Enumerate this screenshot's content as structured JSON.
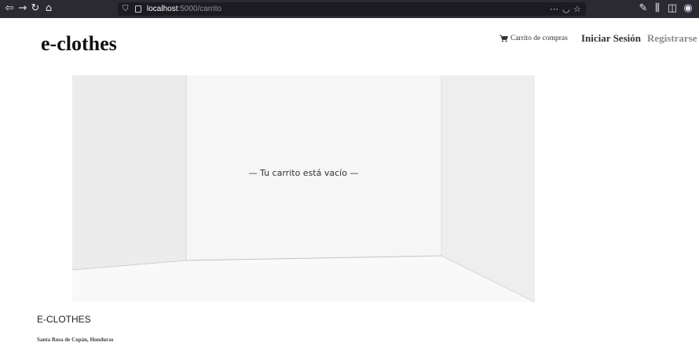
{
  "browser": {
    "url_host": "localhost",
    "url_rest": ":5000/carrito",
    "icons": [
      "back-icon",
      "forward-icon",
      "reload-icon",
      "home-icon",
      "shield-icon",
      "page-icon",
      "more-icon",
      "pocket-icon",
      "star-icon",
      "tools-icon",
      "library-icon",
      "sidebar-icon",
      "profile-icon"
    ]
  },
  "header": {
    "brand": "e-clothes",
    "cart_label": "Carrito de compras",
    "login_label": "Iniciar Sesión",
    "register_label": "Registrarse"
  },
  "main": {
    "empty_message": "— Tu carrito está vacío —"
  },
  "footer": {
    "title": "E-CLOTHES",
    "address": "Santa Rosa de Copán, Honduras"
  },
  "colors": {
    "toolbar": "#2b2a33",
    "urlbar": "#1c1b22",
    "text_dark": "#111111",
    "register_gray": "#8a8a8a"
  }
}
